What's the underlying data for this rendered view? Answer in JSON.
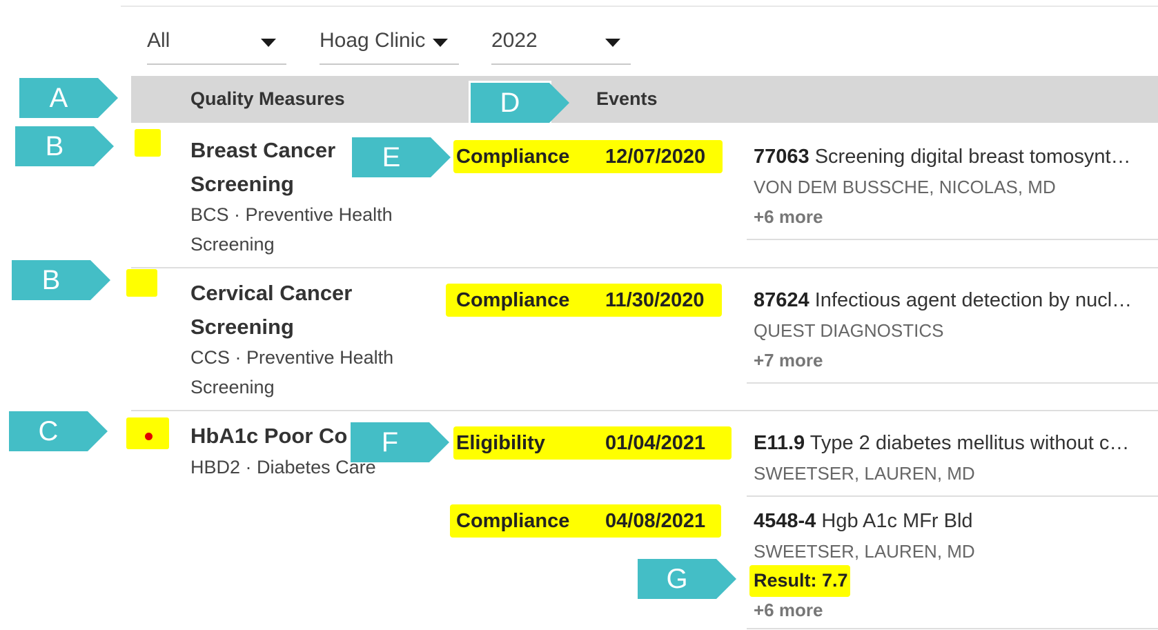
{
  "filters": [
    {
      "value": "All"
    },
    {
      "value": "Hoag Clinic"
    },
    {
      "value": "2022"
    }
  ],
  "header": {
    "quality_measures": "Quality Measures",
    "events": "Events"
  },
  "callouts": {
    "a": "A",
    "b1": "B",
    "b2": "B",
    "c": "C",
    "d": "D",
    "e": "E",
    "f": "F",
    "g": "G"
  },
  "measures": [
    {
      "title_line1": "Breast Cancer",
      "title_line2": "Screening",
      "sub_line1": "BCS · Preventive Health",
      "sub_line2": "Screening",
      "status": "yellow",
      "events": [
        {
          "type": "Compliance",
          "date": "12/07/2020",
          "code": "77063",
          "description": "Screening digital breast tomosynt…",
          "provider": "VON DEM BUSSCHE, NICOLAS, MD",
          "more": "+6 more"
        }
      ]
    },
    {
      "title_line1": "Cervical Cancer",
      "title_line2": "Screening",
      "sub_line1": "CCS · Preventive Health",
      "sub_line2": "Screening",
      "status": "yellow",
      "events": [
        {
          "type": "Compliance",
          "date": "11/30/2020",
          "code": "87624",
          "description": "Infectious agent detection by nucl…",
          "provider": "QUEST DIAGNOSTICS",
          "more": "+7 more"
        }
      ]
    },
    {
      "title_line1": "HbA1c Poor Co",
      "sub_line1": "HBD2 · Diabetes Care",
      "status": "red",
      "events": [
        {
          "type": "Eligibility",
          "date": "01/04/2021",
          "code": "E11.9",
          "description": "Type 2 diabetes mellitus without c…",
          "provider": "SWEETSER, LAUREN, MD"
        },
        {
          "type": "Compliance",
          "date": "04/08/2021",
          "code": "4548-4",
          "description": "Hgb A1c MFr Bld",
          "provider": "SWEETSER, LAUREN, MD",
          "result": "Result: 7.7",
          "more": "+6 more"
        }
      ]
    }
  ],
  "colors": {
    "highlight": "#ffff00",
    "callout": "#44bec6",
    "header_bg": "#d7d7d7",
    "dot": "#e00000"
  }
}
